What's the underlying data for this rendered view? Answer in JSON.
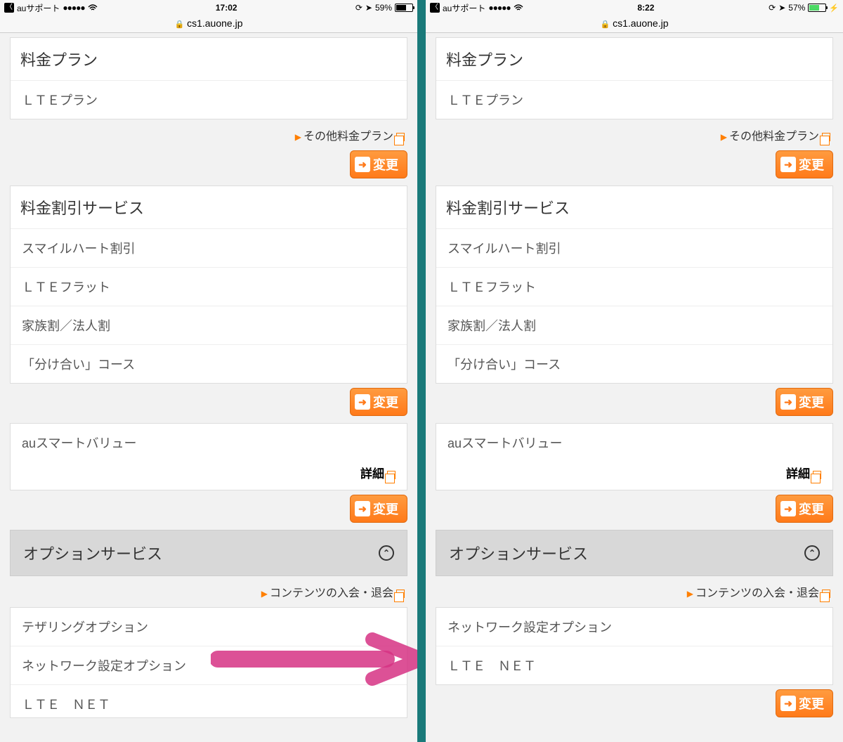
{
  "left": {
    "status": {
      "back_app": "auサポート",
      "signal": "●●●●●",
      "wifi": "wifi-icon",
      "time": "17:02",
      "orientation_lock": "orientation-lock-icon",
      "location": "location-icon",
      "battery_pct": "59%",
      "battery_fill": 59,
      "charging": false
    },
    "url": "cs1.auone.jp",
    "sections": {
      "plan": {
        "header": "料金プラン",
        "items": [
          "ＬＴＥプラン"
        ],
        "link": "その他料金プラン",
        "btn": "変更"
      },
      "discount": {
        "header": "料金割引サービス",
        "items": [
          "スマイルハート割引",
          "ＬＴＥフラット",
          "家族割／法人割",
          "「分け合い」コース"
        ],
        "btn": "変更"
      },
      "smartvalue": {
        "item": "auスマートバリュー",
        "detail": "詳細",
        "btn": "変更"
      },
      "option": {
        "header": "オプションサービス",
        "link": "コンテンツの入会・退会",
        "items": [
          "テザリングオプション",
          "ネットワーク設定オプション",
          "ＬＴＥ　ＮＥＴ"
        ]
      }
    }
  },
  "right": {
    "status": {
      "back_app": "auサポート",
      "signal": "●●●●●",
      "wifi": "wifi-icon",
      "time": "8:22",
      "orientation_lock": "orientation-lock-icon",
      "location": "location-icon",
      "battery_pct": "57%",
      "battery_fill": 57,
      "charging": true
    },
    "url": "cs1.auone.jp",
    "sections": {
      "plan": {
        "header": "料金プラン",
        "items": [
          "ＬＴＥプラン"
        ],
        "link": "その他料金プラン",
        "btn": "変更"
      },
      "discount": {
        "header": "料金割引サービス",
        "items": [
          "スマイルハート割引",
          "ＬＴＥフラット",
          "家族割／法人割",
          "「分け合い」コース"
        ],
        "btn": "変更"
      },
      "smartvalue": {
        "item": "auスマートバリュー",
        "detail": "詳細",
        "btn": "変更"
      },
      "option": {
        "header": "オプションサービス",
        "link": "コンテンツの入会・退会",
        "items": [
          "ネットワーク設定オプション",
          "ＬＴＥ　ＮＥＴ"
        ],
        "btn": "変更"
      }
    }
  }
}
